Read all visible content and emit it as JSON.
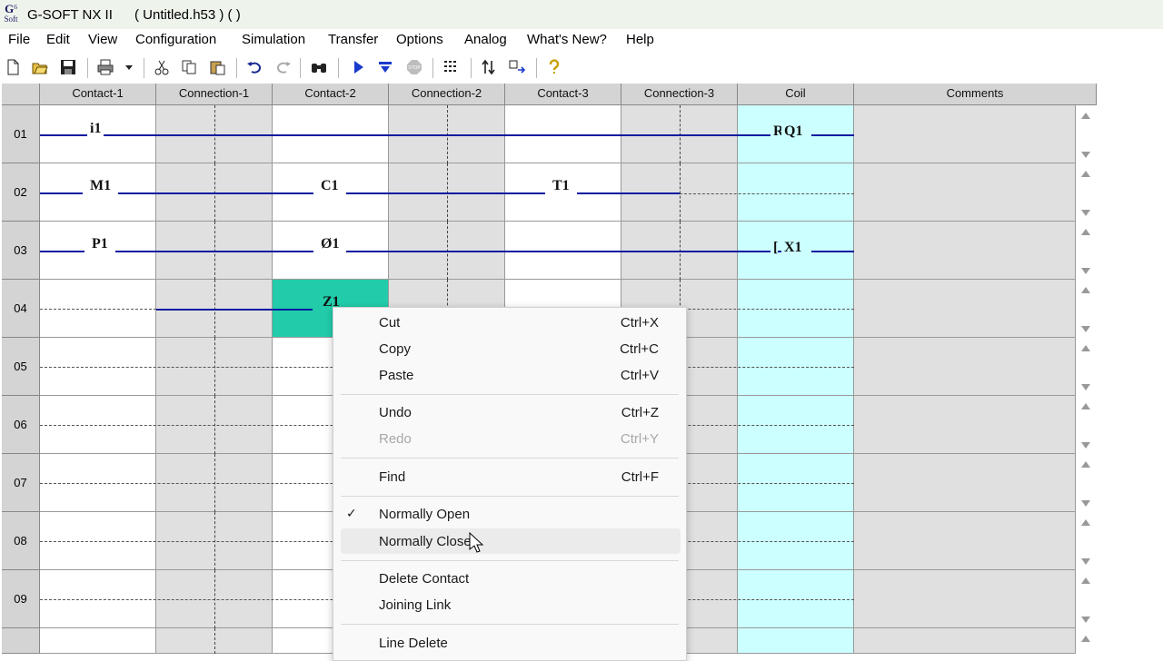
{
  "titlebar": {
    "logo_top": "G",
    "logo_sup": "6",
    "logo_bottom": "Soft",
    "app_name": "G-SOFT NX II",
    "document": "( Untitled.h53 )  (  )"
  },
  "menu": [
    "File",
    "Edit",
    "View",
    "Configuration",
    "Simulation",
    "Transfer",
    "Options",
    "Analog",
    "What's New?",
    "Help"
  ],
  "toolbar_icons": [
    "new-icon",
    "open-icon",
    "save-icon",
    "print-icon",
    "dropdown-icon",
    "cut-icon",
    "copy-icon",
    "paste-icon",
    "undo-icon",
    "redo-icon",
    "find-icon",
    "run-icon",
    "simulate-icon",
    "stop-icon",
    "grid-icon",
    "transfer-icon",
    "compare-icon",
    "help-icon"
  ],
  "columns": [
    "Contact-1",
    "Connection-1",
    "Contact-2",
    "Connection-2",
    "Contact-3",
    "Connection-3",
    "Coil",
    "Comments"
  ],
  "rows": [
    "01",
    "02",
    "03",
    "04",
    "05",
    "06",
    "07",
    "08",
    "09"
  ],
  "ladder": {
    "r1_c1": "i1",
    "r1_coil_prefix": "R",
    "r1_coil": "Q1",
    "r2_c1": "M1",
    "r2_c2": "C1",
    "r2_c3": "T1",
    "r3_c1": "P1",
    "r3_c2": "Ø1",
    "r3_coil_prefix": "[",
    "r3_coil": "X1",
    "r4_c2": "Z1"
  },
  "colors": {
    "rung_line": "#0a1aa0",
    "coil_bg": "#ccffff",
    "selected_cell": "#22ccaa",
    "connection_bg": "#e0e0e0"
  },
  "context_menu": {
    "cut": "Cut",
    "cut_sc": "Ctrl+X",
    "copy": "Copy",
    "copy_sc": "Ctrl+C",
    "paste": "Paste",
    "paste_sc": "Ctrl+V",
    "undo": "Undo",
    "undo_sc": "Ctrl+Z",
    "redo": "Redo",
    "redo_sc": "Ctrl+Y",
    "find": "Find",
    "find_sc": "Ctrl+F",
    "normally_open": "Normally Open",
    "normally_closed": "Normally Close",
    "delete_contact": "Delete Contact",
    "joining_link": "Joining Link",
    "line_delete": "Line Delete",
    "check": "✓"
  }
}
